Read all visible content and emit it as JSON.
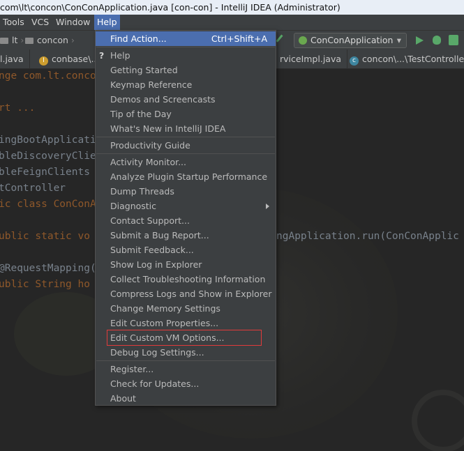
{
  "window": {
    "title": "com\\lt\\concon\\ConConApplication.java [con-con] - IntelliJ IDEA (Administrator)"
  },
  "menubar": {
    "items": [
      "Tools",
      "VCS",
      "Window",
      "Help"
    ]
  },
  "navbar": {
    "crumbs": [
      "lt",
      "concon"
    ],
    "run_config": "ConConApplication"
  },
  "tabs": [
    {
      "label": "l.java",
      "icon": "class-icon"
    },
    {
      "label": "conbase\\...",
      "icon": "interface-icon"
    },
    {
      "label": "rviceImpl.java",
      "icon": "none"
    },
    {
      "label": "concon\\...\\TestController",
      "icon": "class-icon"
    }
  ],
  "editor": {
    "lines": [
      "nge com.lt.conco",
      "rt ...",
      "ingBootApplicati",
      "bleDiscoveryClie",
      "bleFeignClients",
      "tController",
      "ic class ConConA",
      "ublic static vo",
      "ngApplication.run(ConConApplic",
      "@RequestMapping(",
      "ublic String ho"
    ]
  },
  "help_menu": {
    "find_action": {
      "label": "Find Action...",
      "shortcut": "Ctrl+Shift+A"
    },
    "items_group1": [
      "Help",
      "Getting Started",
      "Keymap Reference",
      "Demos and Screencasts",
      "Tip of the Day",
      "What's New in IntelliJ IDEA"
    ],
    "items_group2": [
      "Productivity Guide"
    ],
    "items_group3": [
      "Activity Monitor...",
      "Analyze Plugin Startup Performance",
      "Dump Threads",
      "Diagnostic",
      "Contact Support...",
      "Submit a Bug Report...",
      "Submit Feedback...",
      "Show Log in Explorer",
      "Collect Troubleshooting Information",
      "Compress Logs and Show in Explorer",
      "Change Memory Settings",
      "Edit Custom Properties...",
      "Edit Custom VM Options...",
      "Debug Log Settings..."
    ],
    "items_group4": [
      "Register...",
      "Check for Updates...",
      "About"
    ]
  },
  "colors": {
    "highlight": "#4b6eaf",
    "menu_bg": "#3c3f41",
    "annotation_box": "#e23b3b"
  }
}
